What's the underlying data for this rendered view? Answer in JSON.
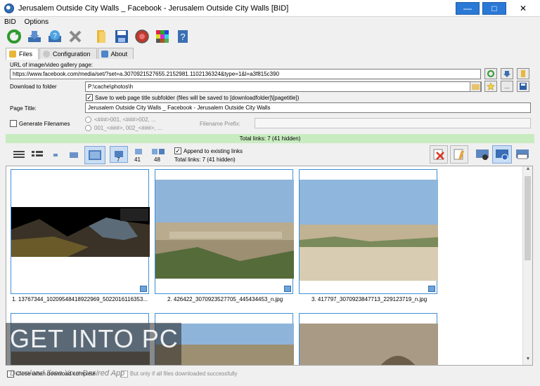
{
  "window": {
    "title": "Jerusalem Outside City Walls _ Facebook - Jerusalem Outside City Walls [BID]",
    "minimize": "—",
    "maximize": "□",
    "close": "✕"
  },
  "menu": [
    "BID",
    "Options"
  ],
  "toolbar_icons": [
    "refresh-icon",
    "download-icon",
    "help-icon",
    "cancel-icon",
    "folder-icon",
    "save-icon",
    "record-icon",
    "grid-icon",
    "info-icon"
  ],
  "tabs": [
    {
      "label": "Files",
      "active": true
    },
    {
      "label": "Configuration",
      "active": false
    },
    {
      "label": "About",
      "active": false
    }
  ],
  "form": {
    "url_label": "URL of image/video gallery page:",
    "url_value": "https://www.facebook.com/media/set/?set=a.3070921527655.2152981.1102136324&type=1&l=a3f815c390",
    "download_label": "Download to folder",
    "download_value": "P:\\cache\\photos\\h",
    "subfolder_checkbox": "Save to web page title subfolder (files will be saved to [downloadfolder]\\[pagetitle])",
    "subfolder_checked": true,
    "page_title_label": "Page Title:",
    "page_title_value": "Jerusalem Outside City Walls _ Facebook - Jerusalem Outside City Walls",
    "generate_label": "Generate Filenames",
    "generate_checked": false,
    "pattern1": "<###>001, <###>002, ...",
    "pattern2": "001_<###>, 002_<###>, ...",
    "prefix_label": "Filename Prefix:",
    "prefix_value": ""
  },
  "status": {
    "total_links": "Total links: 7 (41 hidden)"
  },
  "view": {
    "count_7": "7",
    "count_41": "41",
    "count_48": "48",
    "append_label": "Append to existing links",
    "append_checked": true,
    "total_links": "Total links: 7 (41 hidden)"
  },
  "thumbnails": [
    {
      "caption": "1. 13767344_10209548418922969_5022016116353..."
    },
    {
      "caption": "2. 426422_3070923527705_445434453_n.jpg"
    },
    {
      "caption": "3. 417797_3070923847713_229123719_n.jpg"
    }
  ],
  "bottom": {
    "close_when_complete": "Close when download complete",
    "only_if_all": "But only if all files downloaded successfully"
  },
  "watermark": {
    "text": "GET INTO PC",
    "sub": "Download Free Your Desired App"
  },
  "colors": {
    "status_bg": "#c8ecc0",
    "selected_bg": "#c9ddf4",
    "thumb_border": "#3d8fd6"
  }
}
